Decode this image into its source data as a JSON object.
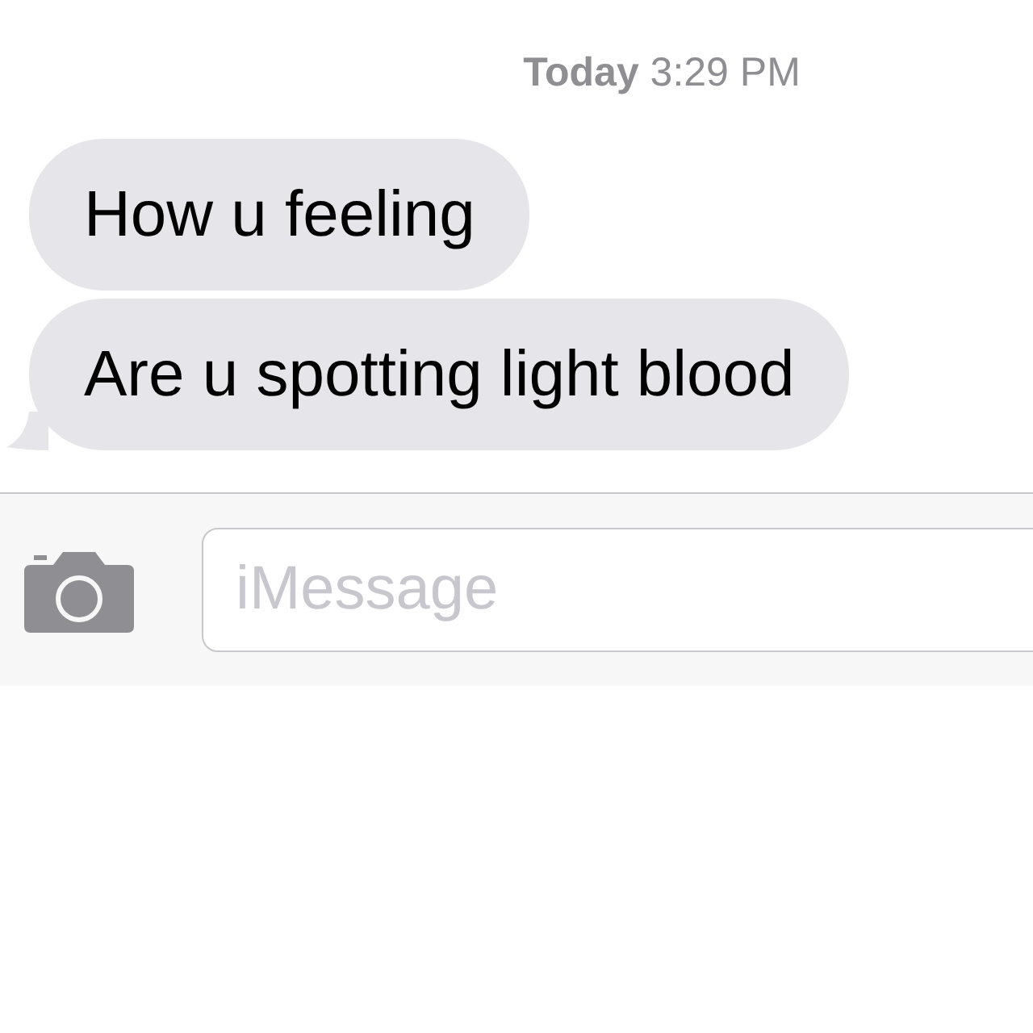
{
  "timestamp": {
    "day": "Today",
    "time": "3:29 PM"
  },
  "messages": [
    {
      "text": "How u feeling"
    },
    {
      "text": "Are u spotting light blood"
    }
  ],
  "composer": {
    "placeholder": "iMessage"
  }
}
